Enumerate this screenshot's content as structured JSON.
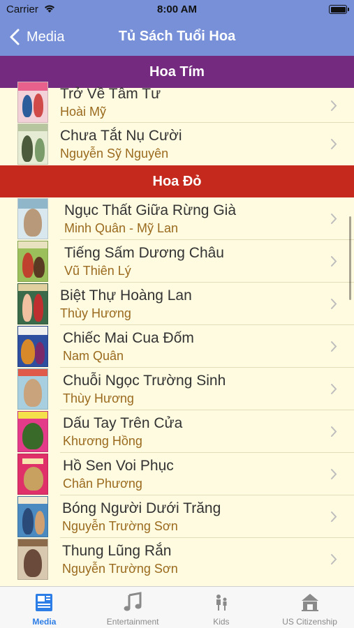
{
  "status": {
    "carrier": "Carrier",
    "time": "8:00 AM"
  },
  "nav": {
    "back_label": "Media",
    "title": "Tủ Sách Tuổi Hoa"
  },
  "colors": {
    "nav": "#7790d8",
    "section_hoa_tim": "#732a7f",
    "section_hoa_do": "#c5281c",
    "author": "#9a6a1e",
    "active_tab": "#2d7de6"
  },
  "sections": [
    {
      "name": "Hoa Tím",
      "color": "#732a7f",
      "books": [
        {
          "title": "Trở Về Tâm Tư",
          "author": "Hoài Mỹ"
        },
        {
          "title": "Chưa Tắt Nụ Cười",
          "author": "Nguyễn Sỹ Nguyên"
        }
      ]
    },
    {
      "name": "Hoa Đỏ",
      "color": "#c5281c",
      "books": [
        {
          "title": "Ngục Thất Giữa Rừng Già",
          "author": "Minh Quân - Mỹ Lan"
        },
        {
          "title": "Tiếng Sấm Dương Châu",
          "author": "Vũ Thiên Lý"
        },
        {
          "title": "Biệt Thự Hoàng Lan",
          "author": "Thùy Hương"
        },
        {
          "title": "Chiếc Mai Cua Đốm",
          "author": "Nam Quân"
        },
        {
          "title": "Chuỗi Ngọc Trường Sinh",
          "author": "Thùy Hương"
        },
        {
          "title": "Dấu Tay Trên Cửa",
          "author": "Khương Hồng"
        },
        {
          "title": "Hồ Sen Voi Phục",
          "author": "Chân Phương"
        },
        {
          "title": "Bóng Người Dưới Trăng",
          "author": "Nguyễn Trường Sơn"
        },
        {
          "title": "Thung Lũng Rắn",
          "author": "Nguyễn Trường Sơn"
        }
      ]
    }
  ],
  "tabs": [
    {
      "label": "Media",
      "icon": "newspaper-icon",
      "active": true
    },
    {
      "label": "Entertainment",
      "icon": "music-note-icon",
      "active": false
    },
    {
      "label": "Kids",
      "icon": "kids-icon",
      "active": false
    },
    {
      "label": "US Citizenship",
      "icon": "capitol-building-icon",
      "active": false
    }
  ]
}
